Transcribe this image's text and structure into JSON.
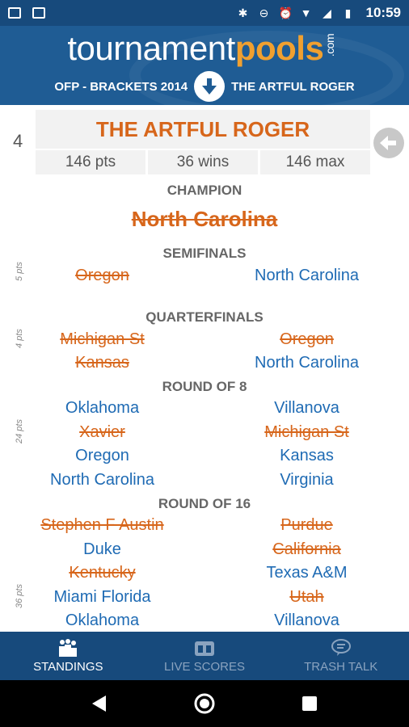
{
  "status_bar": {
    "time": "10:59"
  },
  "header": {
    "logo_part1": "tournament",
    "logo_part2": "pools",
    "logo_part3": ".com",
    "pool_name": "OFP - BRACKETS 2014",
    "entry_name": "THE ARTFUL ROGER"
  },
  "entry": {
    "rank": "4",
    "name": "THE ARTFUL ROGER",
    "points": "146 pts",
    "wins": "36 wins",
    "max": "146 max"
  },
  "champion": {
    "title": "CHAMPION",
    "team": "North Carolina"
  },
  "semifinals": {
    "title": "SEMIFINALS",
    "points": "5 pts",
    "picks": [
      {
        "left": "Oregon",
        "right": "North Carolina"
      }
    ]
  },
  "quarterfinals": {
    "title": "QUARTERFINALS",
    "points": "4 pts",
    "picks": [
      {
        "left": "Michigan St",
        "right": "Oregon"
      },
      {
        "left": "Kansas",
        "right": "North Carolina"
      }
    ]
  },
  "round_of_8": {
    "title": "ROUND OF 8",
    "points": "24 pts",
    "picks": [
      {
        "left": "Oklahoma",
        "right": "Villanova"
      },
      {
        "left": "Xavier",
        "right": "Michigan St"
      },
      {
        "left": "Oregon",
        "right": "Kansas"
      },
      {
        "left": "North Carolina",
        "right": "Virginia"
      }
    ]
  },
  "round_of_16": {
    "title": "ROUND OF 16",
    "points": "36 pts",
    "picks": [
      {
        "left": "Stephen F Austin",
        "right": "Purdue"
      },
      {
        "left": "Duke",
        "right": "California"
      },
      {
        "left": "Kentucky",
        "right": "Texas A&M"
      },
      {
        "left": "Miami Florida",
        "right": "Utah"
      },
      {
        "left": "Oklahoma",
        "right": "Villanova"
      }
    ]
  },
  "bottom_nav": {
    "standings": "STANDINGS",
    "live_scores": "LIVE SCORES",
    "trash_talk": "TRASH TALK"
  },
  "colors": {
    "header_bg": "#1f5c94",
    "accent_orange": "#d7661b",
    "pick_blue": "#1f6bb4",
    "logo_orange": "#f0a030"
  }
}
